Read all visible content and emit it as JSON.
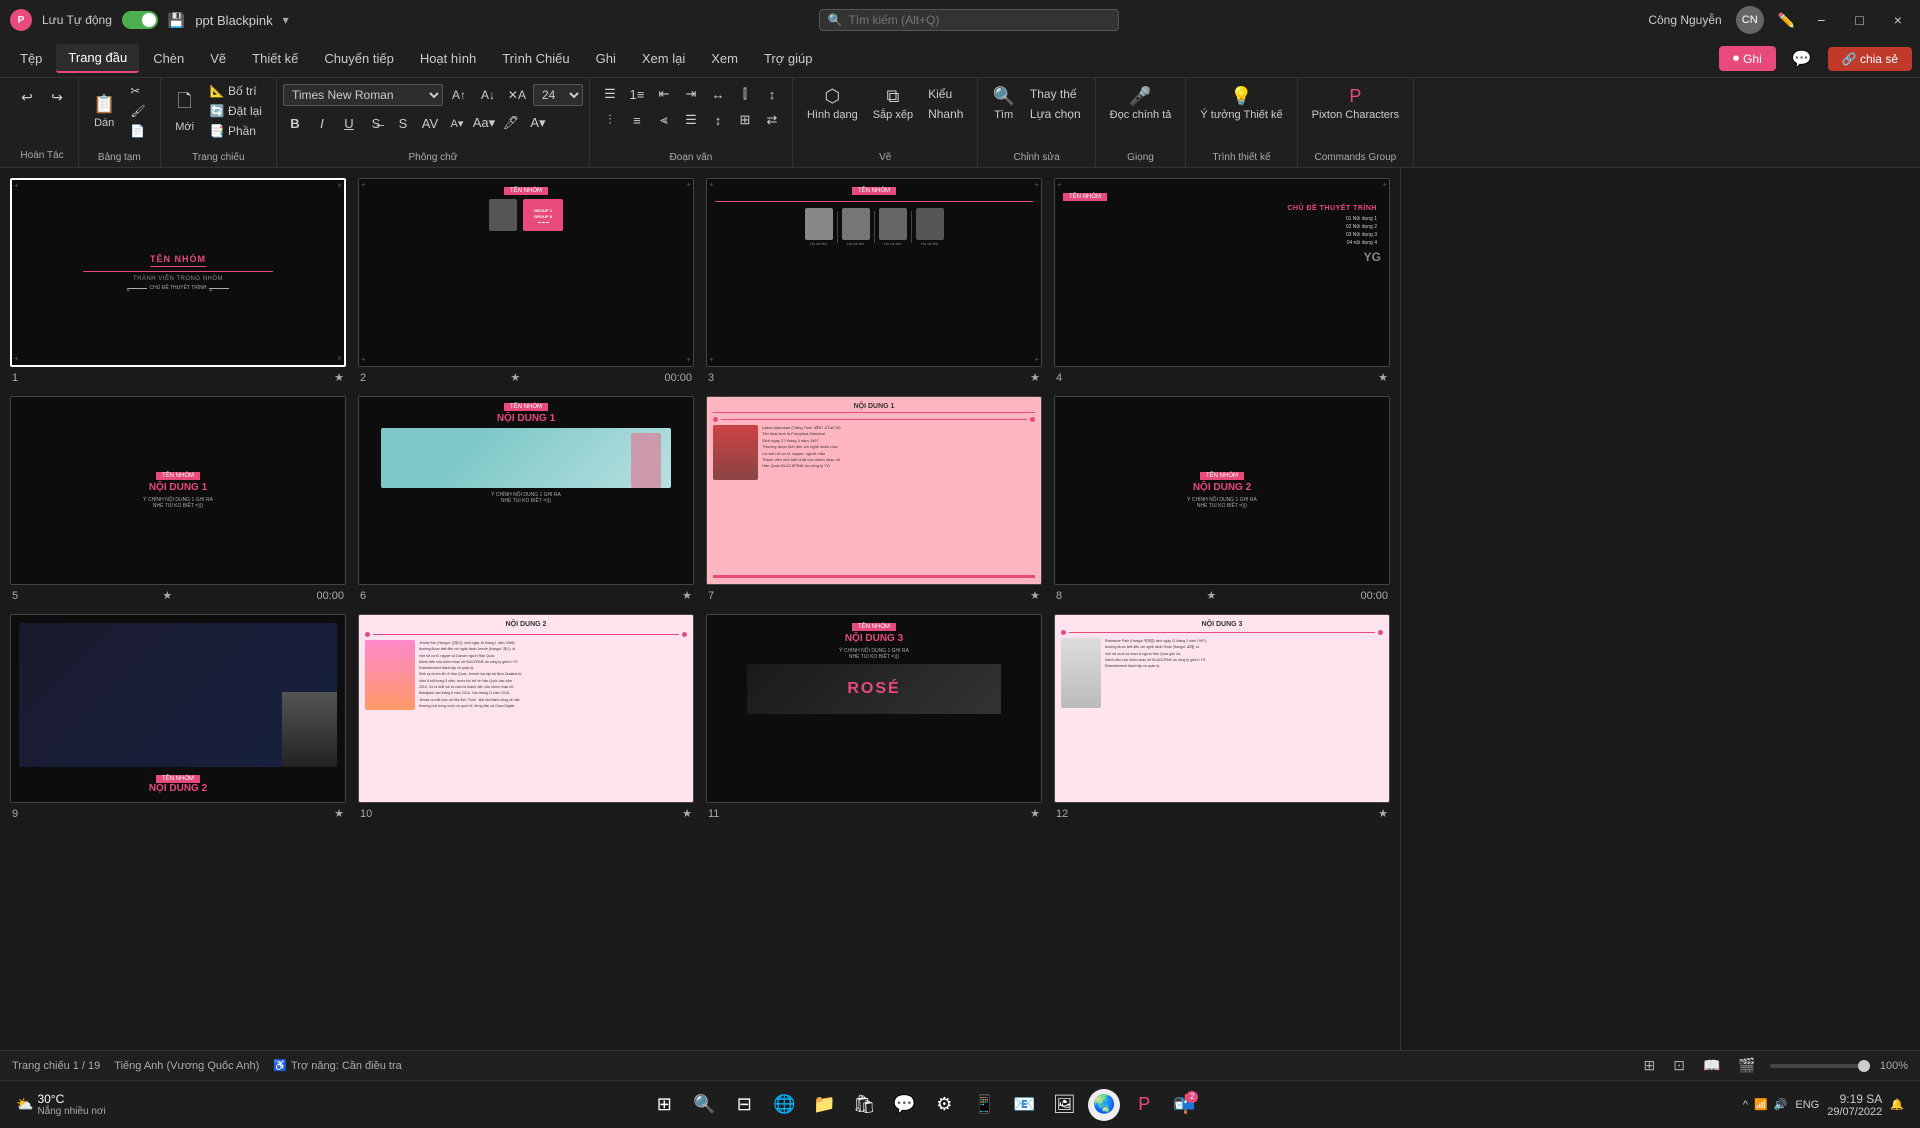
{
  "titlebar": {
    "app_icon": "P",
    "autosave_label": "Lưu Tự động",
    "file_name": "ppt Blackpink",
    "search_placeholder": "Tìm kiếm (Alt+Q)",
    "user_name": "Công Nguyễn",
    "minimize": "−",
    "restore": "□",
    "close": "×"
  },
  "menubar": {
    "items": [
      {
        "label": "Tệp",
        "active": false
      },
      {
        "label": "Trang đầu",
        "active": true
      },
      {
        "label": "Chèn",
        "active": false
      },
      {
        "label": "Vẽ",
        "active": false
      },
      {
        "label": "Thiết kế",
        "active": false
      },
      {
        "label": "Chuyển tiếp",
        "active": false
      },
      {
        "label": "Hoạt hình",
        "active": false
      },
      {
        "label": "Trình Chiếu",
        "active": false
      },
      {
        "label": "Ghi",
        "active": false
      },
      {
        "label": "Xem lại",
        "active": false
      },
      {
        "label": "Xem",
        "active": false
      },
      {
        "label": "Trợ giúp",
        "active": false
      }
    ],
    "btn_record": "Ghi",
    "btn_share": "chia sẻ"
  },
  "ribbon": {
    "undo_label": "Hoàn Tác",
    "clipboard_label": "Bảng tạm",
    "slides_label": "Trang chiếu",
    "font_label": "Phông chữ",
    "paragraph_label": "Đoạn văn",
    "draw_label": "Vẽ",
    "edit_label": "Chỉnh sửa",
    "voice_label": "Giọng",
    "design_label": "Trình thiết kế",
    "commands_label": "Commands Group",
    "font_name": "Times New Roman",
    "font_size": "24",
    "btn_layout": "Bố trí",
    "btn_reset": "Đặt lại",
    "btn_section": "Phần",
    "btn_new": "Mới",
    "btn_paste": "Dán",
    "btn_shape": "Hình dạng",
    "btn_arrange": "Sắp xếp",
    "btn_style": "Kiểu",
    "btn_quick": "Nhanh",
    "btn_find": "Tìm",
    "btn_replace": "Thay thế",
    "btn_select": "Lựa chọn",
    "btn_ideas": "Ý tưởng Thiết kế",
    "btn_pixton": "Pixton Characters",
    "btn_dictate": "Đọc chính tả"
  },
  "slides": [
    {
      "id": 1,
      "num": "1",
      "star": "★",
      "time": "",
      "active": true,
      "content": {
        "type": "title",
        "group_name": "TÊN NHÓM",
        "members": "THÀNH VIÊN TRONG NHÓM",
        "topic": "CHỦ ĐỀ THUYẾT TRÌNH"
      }
    },
    {
      "id": 2,
      "num": "2",
      "star": "★",
      "time": "00:00",
      "content": {
        "type": "member_intro",
        "tag": "TÊN NHÓM",
        "photo": true,
        "card_line1": "GROUP 1",
        "card_line2": "GROUP 5",
        "card_line3": "GROUP 5"
      }
    },
    {
      "id": 3,
      "num": "3",
      "star": "★",
      "time": "",
      "content": {
        "type": "team_photos",
        "tag": "TÊN NHÓM",
        "members": [
          "Họ và tên",
          "Họ và tên",
          "Họ và tên",
          "Họ và tên"
        ]
      }
    },
    {
      "id": 4,
      "num": "4",
      "star": "★",
      "time": "",
      "content": {
        "type": "toc",
        "tag": "TÊN NHÓM",
        "title": "CHỦ ĐỀ THUYẾT TRÌNH",
        "items": [
          "01 Nội dung 1",
          "02 Nội dung 2",
          "03 Nội dung 3",
          "04 nội dung 4"
        ]
      }
    },
    {
      "id": 5,
      "num": "5",
      "star": "★",
      "time": "00:00",
      "content": {
        "type": "content1_dark",
        "tag": "TÊN NHÓM",
        "title": "NỘI DUNG 1",
        "body": "Ý CHÍNH NỘI DUNG 1 GHI RA\nNHÉ TUI KO BIẾT =)))"
      }
    },
    {
      "id": 6,
      "num": "6",
      "star": "★",
      "time": "",
      "content": {
        "type": "content1_img",
        "tag": "TÊN NHÓM",
        "title": "NỘI DUNG 1",
        "body": "Ý CHÍNH NỘI DUNG 1 GHI RA\nNHÉ TUI KO BIẾT =)))"
      }
    },
    {
      "id": 7,
      "num": "7",
      "star": "★",
      "time": "",
      "content": {
        "type": "lisa_bio",
        "tag": "NỘI DUNG 1",
        "text": "Lalisa Manoban..."
      }
    },
    {
      "id": 8,
      "num": "8",
      "star": "★",
      "time": "00:00",
      "content": {
        "type": "content2_dark",
        "tag": "TÊN NHÓM",
        "title": "NỘI DUNG 2",
        "body": "Ý CHÍNH NỘI DUNG 1 GHI RA\nNHÉ TUI KO BIẾT =)))"
      }
    },
    {
      "id": 9,
      "num": "9",
      "star": "★",
      "time": "",
      "content": {
        "type": "nd2_photo",
        "tag": "TÊN NHÓM",
        "title": "NỘI DUNG 2"
      }
    },
    {
      "id": 10,
      "num": "10",
      "star": "★",
      "time": "",
      "content": {
        "type": "jennie_bio",
        "tag": "NỘI DUNG 2",
        "text": "Jennie Kim..."
      }
    },
    {
      "id": 11,
      "num": "11",
      "star": "★",
      "time": "",
      "content": {
        "type": "nd3_photo",
        "tag": "TÊN NHÓM",
        "title": "NỘI DUNG 3"
      }
    },
    {
      "id": 12,
      "num": "12",
      "star": "★",
      "time": "",
      "content": {
        "type": "nd3_bio",
        "tag": "NỘI DUNG 3",
        "text": "Rose bio..."
      }
    }
  ],
  "statusbar": {
    "slide_info": "Trang chiếu 1 / 19",
    "language": "Tiếng Anh (Vương Quốc Anh)",
    "accessibility": "Trợ năng: Cần điều tra",
    "zoom": "100%"
  },
  "taskbar": {
    "time": "9:19 SA",
    "date": "29/07/2022",
    "weather_temp": "30°C",
    "weather_desc": "Nắng nhiều nơi",
    "lang": "ENG"
  },
  "weather": {
    "icon": "☀️",
    "temp": "30°C",
    "desc": "Nắng nhiều nơi"
  }
}
